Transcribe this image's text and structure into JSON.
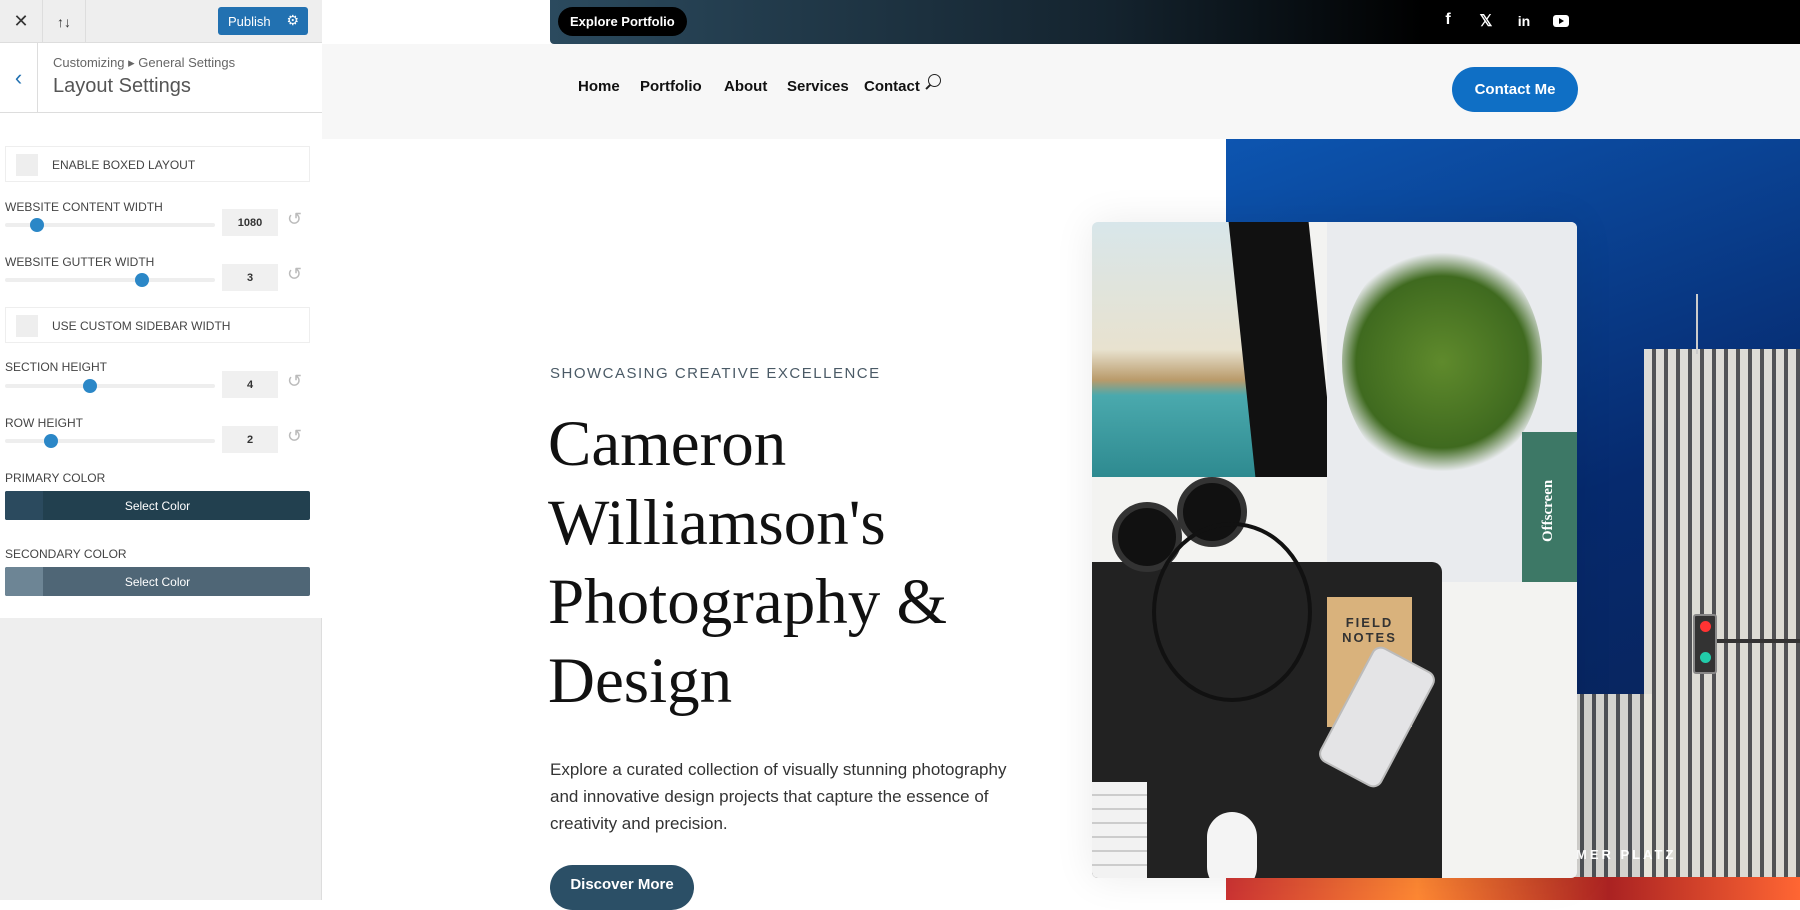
{
  "customizer": {
    "close_icon": "close-icon",
    "reorder_icon": "arrows-up-down-icon",
    "publish_label": "Publish",
    "breadcrumb": "Customizing ▸ General Settings",
    "section_title": "Layout Settings",
    "controls": {
      "boxed_layout": {
        "label": "ENABLE BOXED LAYOUT",
        "checked": false
      },
      "content_width": {
        "label": "WEBSITE CONTENT WIDTH",
        "value": "1080"
      },
      "gutter_width": {
        "label": "WEBSITE GUTTER WIDTH",
        "value": "3"
      },
      "custom_sidebar": {
        "label": "USE CUSTOM SIDEBAR WIDTH",
        "checked": false
      },
      "section_height": {
        "label": "SECTION HEIGHT",
        "value": "4"
      },
      "row_height": {
        "label": "ROW HEIGHT",
        "value": "2"
      },
      "primary_color": {
        "label": "PRIMARY COLOR",
        "button": "Select Color",
        "color": "#2b4a5e"
      },
      "secondary_color": {
        "label": "SECONDARY COLOR",
        "button": "Select Color",
        "color": "#5d7282"
      }
    }
  },
  "site": {
    "topbar": {
      "button": "Explore Portfolio",
      "social": [
        "facebook-icon",
        "x-icon",
        "linkedin-icon",
        "youtube-icon"
      ]
    },
    "nav": {
      "items": [
        "Home",
        "Portfolio",
        "About",
        "Services",
        "Contact"
      ],
      "cta": "Contact Me"
    },
    "hero": {
      "eyebrow": "SHOWCASING CREATIVE EXCELLENCE",
      "title": "Cameron Williamson's Photography & Design",
      "description": "Explore a curated collection of visually stunning photography and innovative design projects that capture the essence of creativity and precision.",
      "button": "Discover More",
      "image_text": {
        "notebook": "FIELD NOTES",
        "magazine": "Offscreen",
        "sign": "MER PLATZ"
      }
    },
    "colors": {
      "accent": "#0f6fc5",
      "dark": "#2b4f66"
    }
  }
}
